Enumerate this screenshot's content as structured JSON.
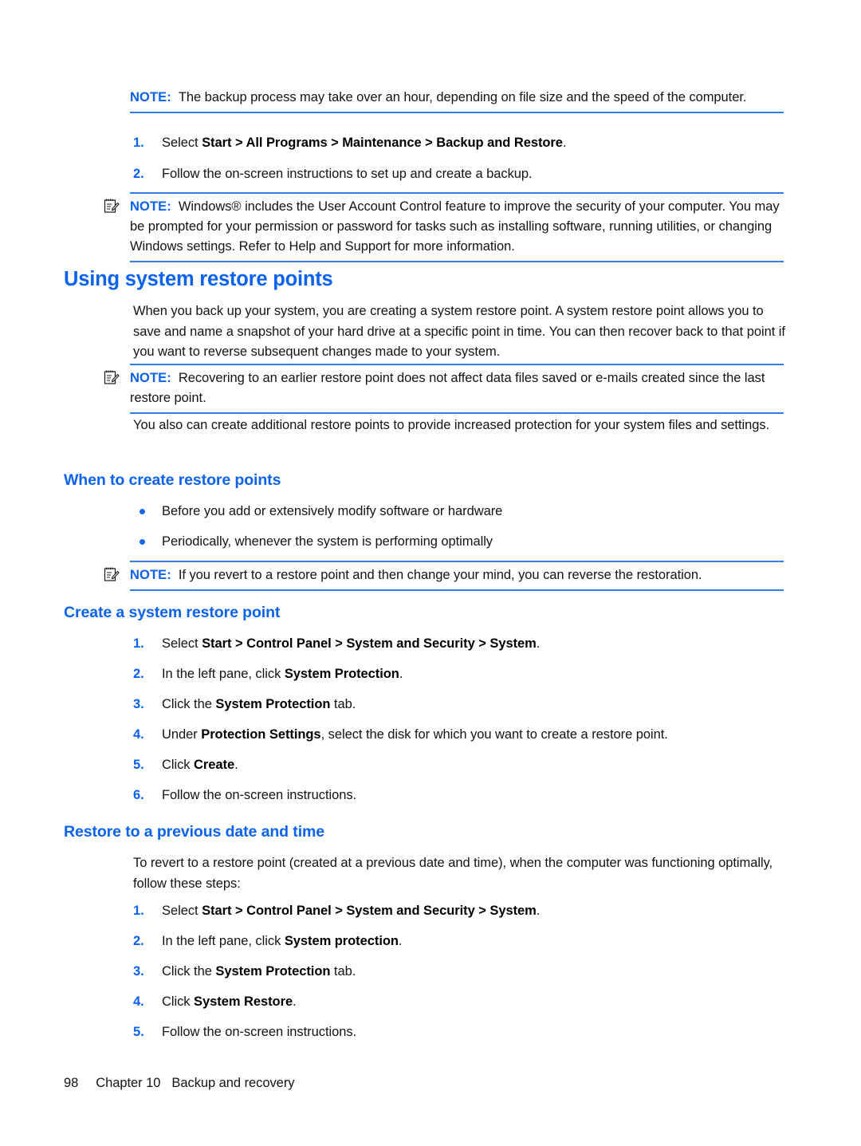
{
  "document": {
    "type": "user-guide-page",
    "accent_color": "#0a62ef",
    "rule_color": "#2f7dea",
    "text_color": "#131313",
    "background": "#ffffff"
  },
  "notes": {
    "note1": {
      "label": "NOTE:",
      "text": "The backup process may take over an hour, depending on file size and the speed of the computer.",
      "has_icon": false
    },
    "note2": {
      "label": "NOTE:",
      "text": "Windows® includes the User Account Control feature to improve the security of your computer. You may be prompted for your permission or password for tasks such as installing software, running utilities, or changing Windows settings. Refer to Help and Support for more information.",
      "has_icon": true,
      "icon": "note-pencil-icon"
    },
    "note3": {
      "label": "NOTE:",
      "text": "Recovering to an earlier restore point does not affect data files saved or e-mails created since the last restore point.",
      "has_icon": true,
      "icon": "note-pencil-icon"
    },
    "note4": {
      "label": "NOTE:",
      "text": "If you revert to a restore point and then change your mind, you can reverse the restoration.",
      "has_icon": true,
      "icon": "note-pencil-icon"
    }
  },
  "top_steps": [
    {
      "num": "1.",
      "prefix": "Select ",
      "bold": "Start > All Programs > Maintenance > Backup and Restore",
      "suffix": "."
    },
    {
      "num": "2.",
      "prefix": "Follow the on-screen instructions to set up and create a backup.",
      "bold": "",
      "suffix": ""
    }
  ],
  "section_using": {
    "heading": "Using system restore points",
    "paragraph1": "When you back up your system, you are creating a system restore point. A system restore point allows you to save and name a snapshot of your hard drive at a specific point in time. You can then recover back to that point if you want to reverse subsequent changes made to your system.",
    "paragraph2": "You also can create additional restore points to provide increased protection for your system files and settings."
  },
  "section_when": {
    "heading": "When to create restore points",
    "bullets": [
      "Before you add or extensively modify software or hardware",
      "Periodically, whenever the system is performing optimally"
    ]
  },
  "section_create": {
    "heading": "Create a system restore point",
    "steps": [
      {
        "num": "1.",
        "prefix": "Select ",
        "bold": "Start > Control Panel > System and Security > System",
        "suffix": "."
      },
      {
        "num": "2.",
        "prefix": "In the left pane, click ",
        "bold": "System Protection",
        "suffix": "."
      },
      {
        "num": "3.",
        "prefix": "Click the ",
        "bold": "System Protection",
        "suffix": " tab."
      },
      {
        "num": "4.",
        "prefix": "Under ",
        "bold": "Protection Settings",
        "suffix": ", select the disk for which you want to create a restore point."
      },
      {
        "num": "5.",
        "prefix": "Click ",
        "bold": "Create",
        "suffix": "."
      },
      {
        "num": "6.",
        "prefix": "Follow the on-screen instructions.",
        "bold": "",
        "suffix": ""
      }
    ]
  },
  "section_restore": {
    "heading": "Restore to a previous date and time",
    "paragraph": "To revert to a restore point (created at a previous date and time), when the computer was functioning optimally, follow these steps:",
    "steps": [
      {
        "num": "1.",
        "prefix": "Select ",
        "bold": "Start > Control Panel > System and Security > System",
        "suffix": "."
      },
      {
        "num": "2.",
        "prefix": "In the left pane, click ",
        "bold": "System protection",
        "suffix": "."
      },
      {
        "num": "3.",
        "prefix": "Click the ",
        "bold": "System Protection",
        "suffix": " tab."
      },
      {
        "num": "4.",
        "prefix": "Click ",
        "bold": "System Restore",
        "suffix": "."
      },
      {
        "num": "5.",
        "prefix": "Follow the on-screen instructions.",
        "bold": "",
        "suffix": ""
      }
    ]
  },
  "footer": {
    "page_number": "98",
    "chapter": "Chapter 10",
    "title": "Backup and recovery"
  }
}
